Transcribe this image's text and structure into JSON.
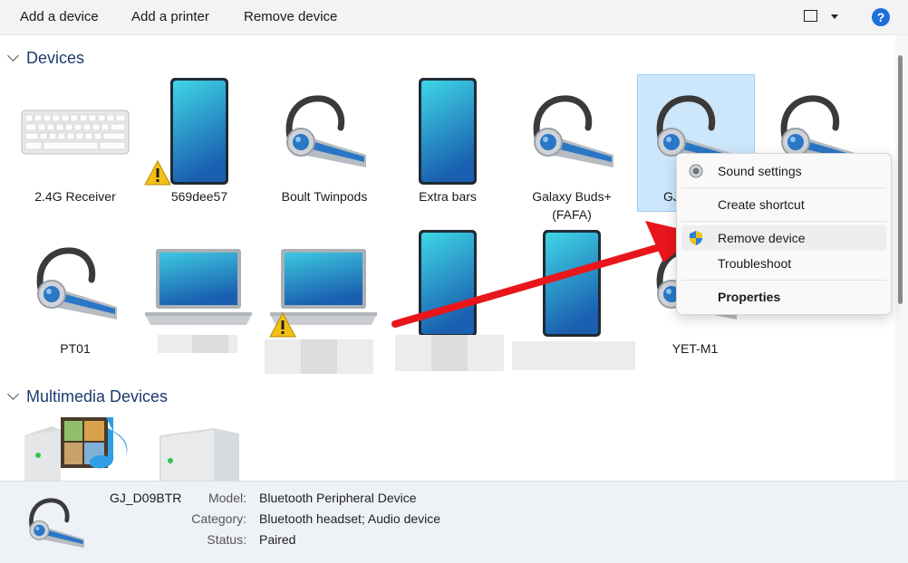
{
  "toolbar": {
    "add_device": "Add a device",
    "add_printer": "Add a printer",
    "remove_device": "Remove device",
    "help": "?"
  },
  "groups": {
    "devices": "Devices",
    "multimedia": "Multimedia Devices"
  },
  "devices": [
    {
      "label": "2.4G Receiver",
      "icon": "keyboard-icon"
    },
    {
      "label": "569dee57",
      "icon": "phone-icon",
      "warning": true
    },
    {
      "label": "Boult Twinpods",
      "icon": "headset-icon"
    },
    {
      "label": "Extra bars",
      "icon": "phone-icon"
    },
    {
      "label": "Galaxy Buds+\n(FAFA)",
      "icon": "headset-icon"
    },
    {
      "label": "GJ",
      "icon": "headset-icon",
      "selected": true
    },
    {
      "label": "",
      "icon": "headset-icon"
    },
    {
      "label": "PT01",
      "icon": "headset-icon"
    },
    {
      "label": "",
      "icon": "laptop-icon"
    },
    {
      "label": "",
      "icon": "laptop-icon",
      "warning": true
    },
    {
      "label": "",
      "icon": "phone-icon"
    },
    {
      "label": "",
      "icon": "phone-icon"
    },
    {
      "label": "YET-M1",
      "icon": "headset-icon"
    }
  ],
  "context_menu": {
    "sound_settings": "Sound settings",
    "create_shortcut": "Create shortcut",
    "remove_device": "Remove device",
    "troubleshoot": "Troubleshoot",
    "properties": "Properties"
  },
  "details": {
    "name": "GJ_D09BTR",
    "model_key": "Model:",
    "model_val": "Bluetooth Peripheral Device",
    "category_key": "Category:",
    "category_val": "Bluetooth headset; Audio device",
    "status_key": "Status:",
    "status_val": "Paired"
  },
  "colors": {
    "accent": "#1e6fd9",
    "selection": "#cce6fb",
    "arrow": "#e8161b",
    "group_header": "#1c3b6e"
  }
}
